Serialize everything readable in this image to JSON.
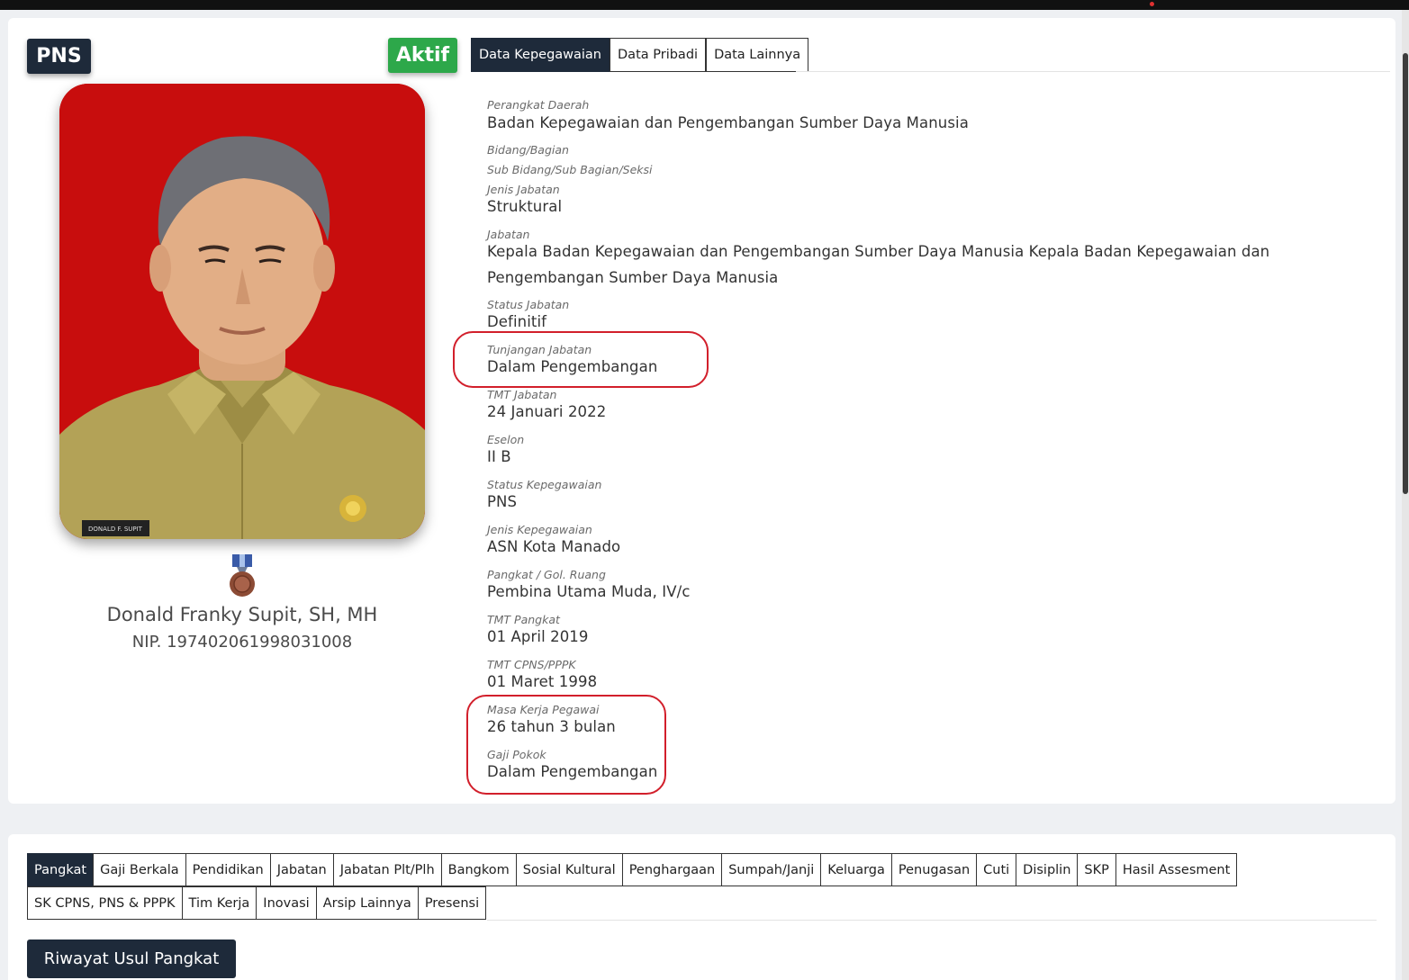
{
  "header": {
    "type_badge": "PNS",
    "status_badge": "Aktif"
  },
  "profile": {
    "name": "Donald Franky Supit, SH, MH",
    "nip": "NIP. 197402061998031008",
    "photo_name_tag": "DONALD F. SUPIT"
  },
  "top_tabs": [
    {
      "label": "Data Kepegawaian",
      "active": true
    },
    {
      "label": "Data Pribadi",
      "active": false
    },
    {
      "label": "Data Lainnya",
      "active": false
    }
  ],
  "fields": {
    "perangkat_daerah": {
      "label": "Perangkat Daerah",
      "value": "Badan Kepegawaian dan Pengembangan Sumber Daya Manusia"
    },
    "bidang_bagian": {
      "label": "Bidang/Bagian",
      "value": ""
    },
    "sub_bidang": {
      "label": "Sub Bidang/Sub Bagian/Seksi",
      "value": ""
    },
    "jenis_jabatan": {
      "label": "Jenis Jabatan",
      "value": "Struktural"
    },
    "jabatan": {
      "label": "Jabatan",
      "value_line1": "Kepala Badan Kepegawaian dan Pengembangan Sumber Daya Manusia Kepala Badan Kepegawaian dan",
      "value_line2": "Pengembangan Sumber Daya Manusia"
    },
    "status_jabatan": {
      "label": "Status Jabatan",
      "value": "Definitif"
    },
    "tunjangan_jabatan": {
      "label": "Tunjangan Jabatan",
      "value": "Dalam Pengembangan"
    },
    "tmt_jabatan": {
      "label": "TMT Jabatan",
      "value": "24 Januari 2022"
    },
    "eselon": {
      "label": "Eselon",
      "value": "II B"
    },
    "status_kepegawaian": {
      "label": "Status Kepegawaian",
      "value": "PNS"
    },
    "jenis_kepegawaian": {
      "label": "Jenis Kepegawaian",
      "value": "ASN Kota Manado"
    },
    "pangkat": {
      "label": "Pangkat / Gol. Ruang",
      "value": "Pembina Utama Muda, IV/c"
    },
    "tmt_pangkat": {
      "label": "TMT Pangkat",
      "value": "01 April 2019"
    },
    "tmt_cpns": {
      "label": "TMT CPNS/PPPK",
      "value": "01 Maret 1998"
    },
    "masa_kerja": {
      "label": "Masa Kerja Pegawai",
      "value": "26 tahun 3 bulan"
    },
    "gaji_pokok": {
      "label": "Gaji Pokok",
      "value": "Dalam Pengembangan"
    }
  },
  "bottom_tabs_row1": [
    {
      "label": "Pangkat",
      "active": true
    },
    {
      "label": "Gaji Berkala"
    },
    {
      "label": "Pendidikan"
    },
    {
      "label": "Jabatan"
    },
    {
      "label": "Jabatan Plt/Plh"
    },
    {
      "label": "Bangkom"
    },
    {
      "label": "Sosial Kultural"
    },
    {
      "label": "Penghargaan"
    },
    {
      "label": "Sumpah/Janji"
    },
    {
      "label": "Keluarga"
    },
    {
      "label": "Penugasan"
    },
    {
      "label": "Cuti"
    },
    {
      "label": "Disiplin"
    },
    {
      "label": "SKP"
    },
    {
      "label": "Hasil Assesment"
    }
  ],
  "bottom_tabs_row2": [
    {
      "label": "SK CPNS, PNS & PPPK"
    },
    {
      "label": "Tim Kerja"
    },
    {
      "label": "Inovasi"
    },
    {
      "label": "Arsip Lainnya"
    },
    {
      "label": "Presensi"
    }
  ],
  "actions": {
    "riwayat_button": "Riwayat Usul Pangkat"
  },
  "colors": {
    "dark_navy": "#1e2a3a",
    "active_green": "#2da84a",
    "annotation_red": "#d21f2b",
    "photo_background": "#c80d0d"
  },
  "icons": {
    "medal": "medal-icon"
  }
}
